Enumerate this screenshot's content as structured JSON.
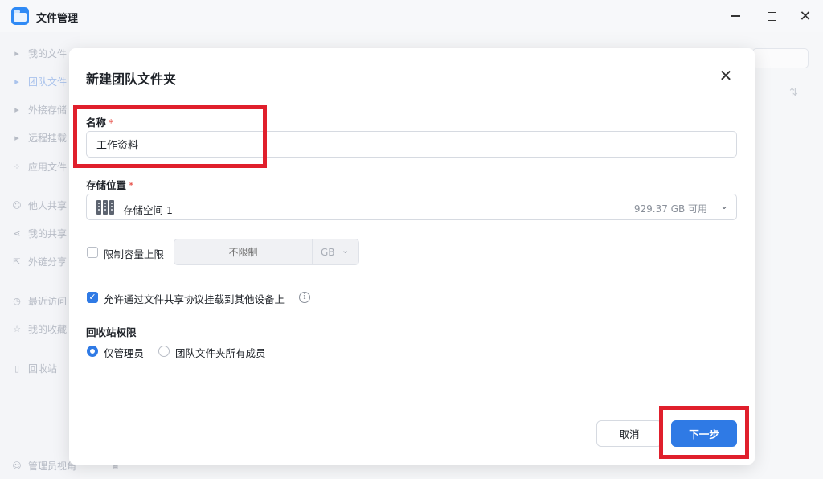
{
  "window": {
    "title": "文件管理"
  },
  "sidebar": {
    "items": [
      {
        "label": "我的文件",
        "icon": "caret-right-icon"
      },
      {
        "label": "团队文件",
        "icon": "caret-right-icon",
        "active": true
      },
      {
        "label": "外接存储",
        "icon": "caret-right-icon"
      },
      {
        "label": "远程挂载",
        "icon": "caret-right-icon"
      },
      {
        "label": "应用文件",
        "icon": "apps-icon"
      },
      {
        "label": "他人共享",
        "icon": "users-icon"
      },
      {
        "label": "我的共享",
        "icon": "share-icon"
      },
      {
        "label": "外链分享",
        "icon": "link-share-icon"
      },
      {
        "label": "最近访问",
        "icon": "clock-icon"
      },
      {
        "label": "我的收藏",
        "icon": "star-icon"
      },
      {
        "label": "回收站",
        "icon": "trash-icon"
      },
      {
        "label": "管理员视角",
        "icon": "admin-icon"
      }
    ]
  },
  "dialog": {
    "title": "新建团队文件夹",
    "name_label": "名称",
    "required_mark": "*",
    "name_value": "工作资料",
    "storage_label": "存储位置",
    "storage_value": "存储空间 1",
    "storage_available": "929.37 GB 可用",
    "limit_label": "限制容量上限",
    "limit_checked": false,
    "limit_placeholder": "不限制",
    "limit_unit": "GB",
    "mount_label": "允许通过文件共享协议挂载到其他设备上",
    "mount_checked": true,
    "recycle_label": "回收站权限",
    "recycle_options": [
      {
        "label": "仅管理员",
        "selected": true
      },
      {
        "label": "团队文件夹所有成员",
        "selected": false
      }
    ],
    "cancel_label": "取消",
    "next_label": "下一步"
  },
  "colors": {
    "accent": "#2f7ae5",
    "required": "#e5433b",
    "highlight": "#e01f2c"
  }
}
